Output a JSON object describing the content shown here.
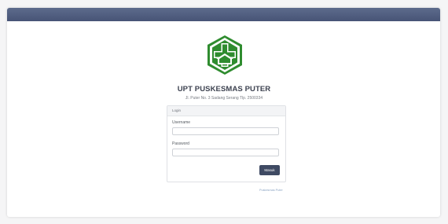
{
  "header": {
    "title": "UPT PUSKESMAS PUTER",
    "address": "Jl. Puter No. 3 Sadang Serang Tlp. 2500334"
  },
  "login": {
    "heading": "Login",
    "username_label": "Username",
    "username_value": "",
    "password_label": "Password",
    "password_value": "",
    "submit_label": "Masuk"
  },
  "footer": {
    "link_text": "Puskesmas Puter"
  },
  "colors": {
    "navbar": "#4f5b7c",
    "logo_green": "#2e8b2e",
    "button": "#3f4a63"
  },
  "icons": {
    "logo": "puskesmas-logo-icon"
  }
}
